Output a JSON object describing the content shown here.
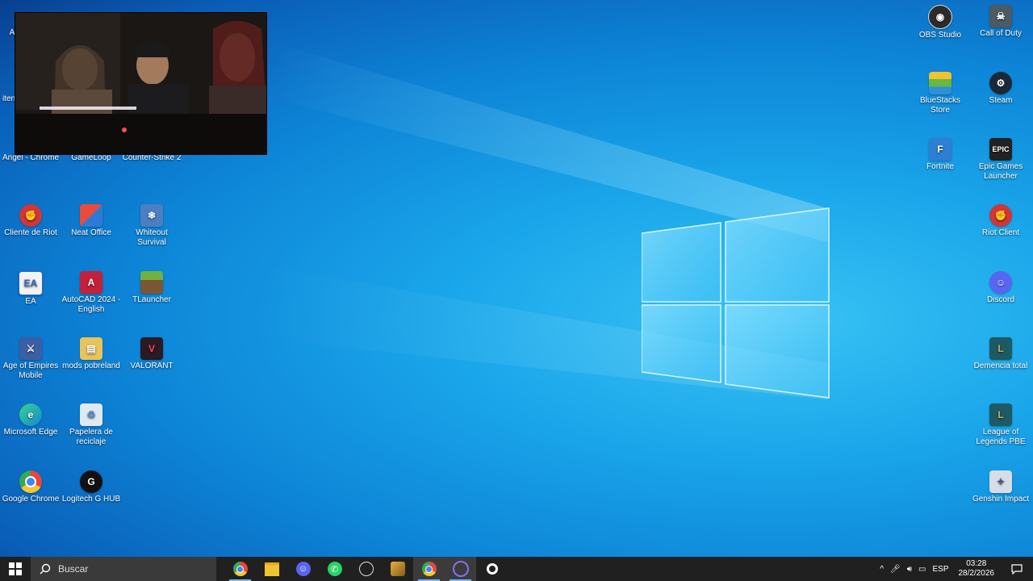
{
  "desktop": {
    "left_icons": [
      {
        "label": "Angel - Chrome",
        "icon": "chrome-icon",
        "color": "#e8453c"
      },
      {
        "label": "GameLoop",
        "icon": "gameloop-icon",
        "color": "#3aa655"
      },
      {
        "label": "Counter-Strike 2",
        "icon": "cs2-icon",
        "color": "#e19a2a"
      },
      {
        "label": "Cliente de Riot",
        "icon": "riot-icon",
        "color": "#d13639"
      },
      {
        "label": "Neat Office",
        "icon": "neat-office-icon",
        "color": "#2b7bd6"
      },
      {
        "label": "Whiteout Survival",
        "icon": "whiteout-icon",
        "color": "#4a7fc1"
      },
      {
        "label": "EA",
        "icon": "ea-icon",
        "color": "#2c67c4"
      },
      {
        "label": "AutoCAD 2024 - English",
        "icon": "autocad-icon",
        "color": "#c4203a"
      },
      {
        "label": "TLauncher",
        "icon": "tlauncher-icon",
        "color": "#4e8a34"
      },
      {
        "label": "Age of Empires Mobile",
        "icon": "aoe-icon",
        "color": "#3b5fa3"
      },
      {
        "label": "mods pobreland",
        "icon": "folder-icon",
        "color": "#e8c35a"
      },
      {
        "label": "VALORANT",
        "icon": "valorant-icon",
        "color": "#2a1a24"
      },
      {
        "label": "Microsoft Edge",
        "icon": "edge-icon",
        "color": "#0f8bd6"
      },
      {
        "label": "Papelera de reciclaje",
        "icon": "recycle-bin-icon",
        "color": "#dfe9f2"
      },
      {
        "label": "Google Chrome",
        "icon": "chrome-icon",
        "color": "#e8453c"
      },
      {
        "label": "Logitech G HUB",
        "icon": "logitech-icon",
        "color": "#111111"
      }
    ],
    "right_icons": [
      {
        "label": "OBS Studio",
        "icon": "obs-icon",
        "color": "#2b2b2b"
      },
      {
        "label": "Call of Duty",
        "icon": "cod-icon",
        "color": "#4b5a63"
      },
      {
        "label": "BlueStacks Store",
        "icon": "bluestacks-icon",
        "color": "#68b841"
      },
      {
        "label": "Steam",
        "icon": "steam-icon",
        "color": "#1b2838"
      },
      {
        "label": "Fortnite",
        "icon": "fortnite-icon",
        "color": "#2d7fd3"
      },
      {
        "label": "Epic Games Launcher",
        "icon": "epic-icon",
        "color": "#222222"
      },
      {
        "label": "Riot Client",
        "icon": "riot-icon",
        "color": "#d13639"
      },
      {
        "label": "Discord",
        "icon": "discord-icon",
        "color": "#5865f2"
      },
      {
        "label": "Demencia total",
        "icon": "league-icon",
        "color": "#1d5a63"
      },
      {
        "label": "League of Legends PBE",
        "icon": "league-icon",
        "color": "#1d5a63"
      },
      {
        "label": "Genshin Impact",
        "icon": "genshin-icon",
        "color": "#d6dde6"
      }
    ],
    "partial_labels": [
      "A",
      "iten"
    ]
  },
  "taskbar": {
    "search_placeholder": "Buscar",
    "apps": [
      {
        "name": "chrome-icon"
      },
      {
        "name": "file-explorer-icon"
      },
      {
        "name": "discord-icon"
      },
      {
        "name": "whatsapp-icon"
      },
      {
        "name": "obs-icon"
      },
      {
        "name": "game-icon"
      },
      {
        "name": "chrome-icon"
      },
      {
        "name": "media-icon"
      },
      {
        "name": "steelseries-icon"
      }
    ],
    "tray": {
      "language": "ESP",
      "time": "03:28",
      "date": "28/2/2026"
    }
  }
}
